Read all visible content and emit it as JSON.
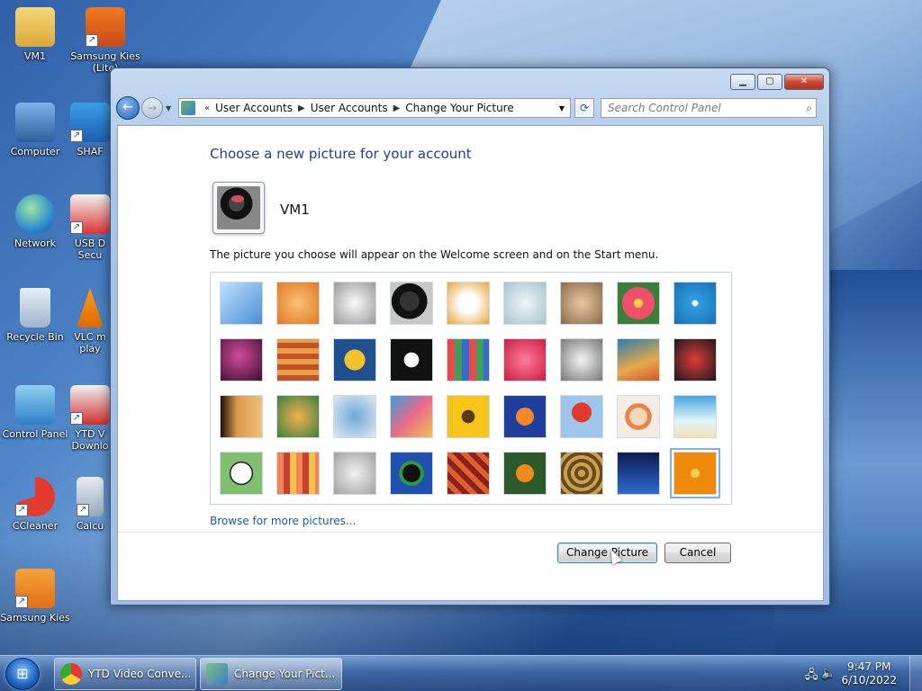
{
  "desktop": {
    "icons": [
      {
        "label": "VM1"
      },
      {
        "label": "Samsung Kies (Lite)"
      },
      {
        "label": "Computer"
      },
      {
        "label": "SHAF"
      },
      {
        "label": "Network"
      },
      {
        "label": "USB D Secu"
      },
      {
        "label": "Recycle Bin"
      },
      {
        "label": "VLC m play"
      },
      {
        "label": "Control Panel"
      },
      {
        "label": "YTD V Downlo"
      },
      {
        "label": "CCleaner"
      },
      {
        "label": "Calcu"
      },
      {
        "label": "Samsung Kies"
      }
    ]
  },
  "window": {
    "breadcrumbs": [
      "User Accounts",
      "User Accounts",
      "Change Your Picture"
    ],
    "search_placeholder": "Search Control Panel",
    "heading": "Choose a new picture for your account",
    "username": "VM1",
    "description": "The picture you choose will appear on the Welcome screen and on the Start menu.",
    "browse_link": "Browse for more pictures...",
    "change_button": "Change Picture",
    "cancel_button": "Cancel",
    "pictures": [
      "roller-coaster",
      "starfish",
      "robot-figure",
      "turntable",
      "lucky-cat",
      "gyroscope",
      "kitten",
      "pink-flower",
      "ferris-wheel",
      "ball",
      "fabric",
      "leaf",
      "dog",
      "crayons",
      "star-lantern",
      "jacks",
      "stairs",
      "paper-crane",
      "guitar",
      "puppy",
      "robot-toy",
      "silk",
      "sunflower",
      "fish",
      "hot-air-balloon",
      "doll",
      "sailboat",
      "soccer-ball",
      "striped-fabric",
      "marbles",
      "window",
      "rug",
      "butterfly",
      "wicker",
      "lighthouse",
      "orange-flower"
    ],
    "selected_picture": "orange-flower"
  },
  "taskbar": {
    "items": [
      {
        "label": "YTD Video Conve..."
      },
      {
        "label": "Change Your Pict..."
      }
    ],
    "time": "9:47 PM",
    "date": "6/10/2022"
  }
}
